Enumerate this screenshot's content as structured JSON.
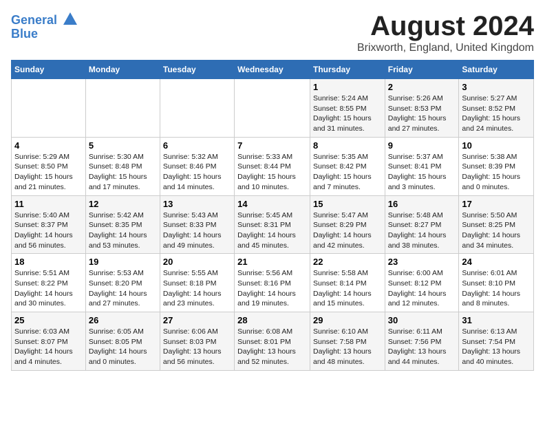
{
  "logo": {
    "line1": "General",
    "line2": "Blue"
  },
  "title": "August 2024",
  "subtitle": "Brixworth, England, United Kingdom",
  "days_header": [
    "Sunday",
    "Monday",
    "Tuesday",
    "Wednesday",
    "Thursday",
    "Friday",
    "Saturday"
  ],
  "weeks": [
    [
      {
        "day": "",
        "info": ""
      },
      {
        "day": "",
        "info": ""
      },
      {
        "day": "",
        "info": ""
      },
      {
        "day": "",
        "info": ""
      },
      {
        "day": "1",
        "info": "Sunrise: 5:24 AM\nSunset: 8:55 PM\nDaylight: 15 hours\nand 31 minutes."
      },
      {
        "day": "2",
        "info": "Sunrise: 5:26 AM\nSunset: 8:53 PM\nDaylight: 15 hours\nand 27 minutes."
      },
      {
        "day": "3",
        "info": "Sunrise: 5:27 AM\nSunset: 8:52 PM\nDaylight: 15 hours\nand 24 minutes."
      }
    ],
    [
      {
        "day": "4",
        "info": "Sunrise: 5:29 AM\nSunset: 8:50 PM\nDaylight: 15 hours\nand 21 minutes."
      },
      {
        "day": "5",
        "info": "Sunrise: 5:30 AM\nSunset: 8:48 PM\nDaylight: 15 hours\nand 17 minutes."
      },
      {
        "day": "6",
        "info": "Sunrise: 5:32 AM\nSunset: 8:46 PM\nDaylight: 15 hours\nand 14 minutes."
      },
      {
        "day": "7",
        "info": "Sunrise: 5:33 AM\nSunset: 8:44 PM\nDaylight: 15 hours\nand 10 minutes."
      },
      {
        "day": "8",
        "info": "Sunrise: 5:35 AM\nSunset: 8:42 PM\nDaylight: 15 hours\nand 7 minutes."
      },
      {
        "day": "9",
        "info": "Sunrise: 5:37 AM\nSunset: 8:41 PM\nDaylight: 15 hours\nand 3 minutes."
      },
      {
        "day": "10",
        "info": "Sunrise: 5:38 AM\nSunset: 8:39 PM\nDaylight: 15 hours\nand 0 minutes."
      }
    ],
    [
      {
        "day": "11",
        "info": "Sunrise: 5:40 AM\nSunset: 8:37 PM\nDaylight: 14 hours\nand 56 minutes."
      },
      {
        "day": "12",
        "info": "Sunrise: 5:42 AM\nSunset: 8:35 PM\nDaylight: 14 hours\nand 53 minutes."
      },
      {
        "day": "13",
        "info": "Sunrise: 5:43 AM\nSunset: 8:33 PM\nDaylight: 14 hours\nand 49 minutes."
      },
      {
        "day": "14",
        "info": "Sunrise: 5:45 AM\nSunset: 8:31 PM\nDaylight: 14 hours\nand 45 minutes."
      },
      {
        "day": "15",
        "info": "Sunrise: 5:47 AM\nSunset: 8:29 PM\nDaylight: 14 hours\nand 42 minutes."
      },
      {
        "day": "16",
        "info": "Sunrise: 5:48 AM\nSunset: 8:27 PM\nDaylight: 14 hours\nand 38 minutes."
      },
      {
        "day": "17",
        "info": "Sunrise: 5:50 AM\nSunset: 8:25 PM\nDaylight: 14 hours\nand 34 minutes."
      }
    ],
    [
      {
        "day": "18",
        "info": "Sunrise: 5:51 AM\nSunset: 8:22 PM\nDaylight: 14 hours\nand 30 minutes."
      },
      {
        "day": "19",
        "info": "Sunrise: 5:53 AM\nSunset: 8:20 PM\nDaylight: 14 hours\nand 27 minutes."
      },
      {
        "day": "20",
        "info": "Sunrise: 5:55 AM\nSunset: 8:18 PM\nDaylight: 14 hours\nand 23 minutes."
      },
      {
        "day": "21",
        "info": "Sunrise: 5:56 AM\nSunset: 8:16 PM\nDaylight: 14 hours\nand 19 minutes."
      },
      {
        "day": "22",
        "info": "Sunrise: 5:58 AM\nSunset: 8:14 PM\nDaylight: 14 hours\nand 15 minutes."
      },
      {
        "day": "23",
        "info": "Sunrise: 6:00 AM\nSunset: 8:12 PM\nDaylight: 14 hours\nand 12 minutes."
      },
      {
        "day": "24",
        "info": "Sunrise: 6:01 AM\nSunset: 8:10 PM\nDaylight: 14 hours\nand 8 minutes."
      }
    ],
    [
      {
        "day": "25",
        "info": "Sunrise: 6:03 AM\nSunset: 8:07 PM\nDaylight: 14 hours\nand 4 minutes."
      },
      {
        "day": "26",
        "info": "Sunrise: 6:05 AM\nSunset: 8:05 PM\nDaylight: 14 hours\nand 0 minutes."
      },
      {
        "day": "27",
        "info": "Sunrise: 6:06 AM\nSunset: 8:03 PM\nDaylight: 13 hours\nand 56 minutes."
      },
      {
        "day": "28",
        "info": "Sunrise: 6:08 AM\nSunset: 8:01 PM\nDaylight: 13 hours\nand 52 minutes."
      },
      {
        "day": "29",
        "info": "Sunrise: 6:10 AM\nSunset: 7:58 PM\nDaylight: 13 hours\nand 48 minutes."
      },
      {
        "day": "30",
        "info": "Sunrise: 6:11 AM\nSunset: 7:56 PM\nDaylight: 13 hours\nand 44 minutes."
      },
      {
        "day": "31",
        "info": "Sunrise: 6:13 AM\nSunset: 7:54 PM\nDaylight: 13 hours\nand 40 minutes."
      }
    ]
  ]
}
